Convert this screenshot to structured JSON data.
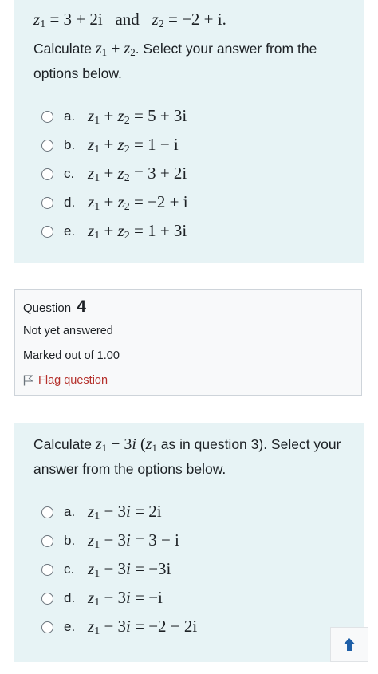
{
  "q3": {
    "header_z1": "3 + 2i",
    "header_and": "and",
    "header_z2": "−2 + i.",
    "text_before": "Calculate ",
    "text_expr": "z1 + z2",
    "text_after": ". Select your answer from the options below.",
    "options": [
      {
        "letter": "a.",
        "result": "5 + 3i"
      },
      {
        "letter": "b.",
        "result": "1 − i"
      },
      {
        "letter": "c.",
        "result": "3 + 2i"
      },
      {
        "letter": "d.",
        "result": "−2 + i"
      },
      {
        "letter": "e.",
        "result": "1 + 3i"
      }
    ]
  },
  "q4_info": {
    "question_label": "Question",
    "question_number": "4",
    "state": "Not yet answered",
    "grade": "Marked out of 1.00",
    "flag_label": "Flag question"
  },
  "q4": {
    "text_before": "Calculate ",
    "text_after": " as in question 3). Select your answer from the options below.",
    "options": [
      {
        "letter": "a.",
        "result": "2i"
      },
      {
        "letter": "b.",
        "result": "3 − i"
      },
      {
        "letter": "c.",
        "result": "−3i"
      },
      {
        "letter": "d.",
        "result": "−i"
      },
      {
        "letter": "e.",
        "result": "−2 − 2i"
      }
    ]
  },
  "colors": {
    "panel_bg": "#e7f3f5",
    "flag": "#b5302b",
    "arrow": "#1e5fa8"
  },
  "icons": {
    "radio": "radio-circle",
    "flag": "flag-outline-icon",
    "back_to_top": "arrow-up-icon"
  }
}
